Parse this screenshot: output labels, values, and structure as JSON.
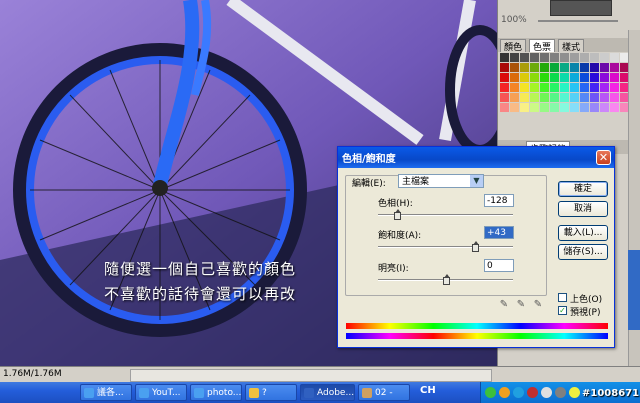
{
  "overlay": {
    "line1": "隨便選一個自己喜歡的顏色",
    "line2": "不喜歡的話待會還可以再改"
  },
  "panels": {
    "zoom": "100%",
    "tabs": [
      "顏色",
      "色票",
      "樣式"
    ],
    "history_tab": "步驟記錄"
  },
  "status": {
    "doc_size": "1.76M/1.76M"
  },
  "taskbar": {
    "items": [
      "議各...",
      "YouT...",
      "photo...",
      "?",
      "Adobe...",
      "02 -"
    ],
    "ime": "CH",
    "watermark": "#1008671"
  },
  "dialog": {
    "title": "色相/飽和度",
    "edit_label": "編輯(E):",
    "edit_value": "主檔案",
    "hue_label": "色相(H):",
    "hue_value": "-128",
    "saturation_label": "飽和度(A):",
    "saturation_value": "+43",
    "lightness_label": "明亮(I):",
    "lightness_value": "0",
    "ok": "確定",
    "cancel": "取消",
    "load": "載入(L)...",
    "save": "儲存(S)...",
    "colorize": "上色(O)",
    "preview": "預視(P)",
    "preview_checked": true,
    "hue_level": 0.14,
    "saturation_level": 0.72,
    "lightness_level": 0.5
  },
  "colors": {
    "titlebar": "#0a5ae8",
    "taskbar": "#245edb",
    "photo_tint": "#6a52b0"
  }
}
